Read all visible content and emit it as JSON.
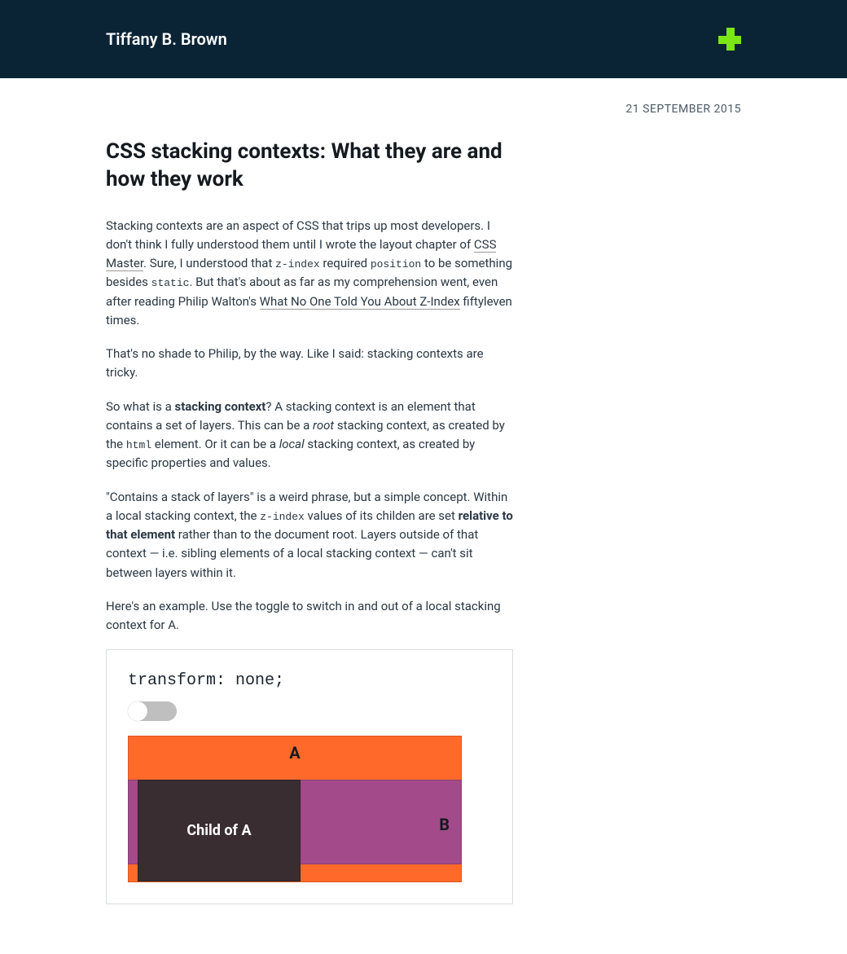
{
  "header": {
    "brand": "Tiffany B. Brown"
  },
  "meta": {
    "date": "21 SEPTEMBER 2015"
  },
  "article": {
    "title": "CSS stacking contexts: What they are and how they work",
    "p1_a": "Stacking contexts are an aspect of CSS that trips up most developers. I don't think I fully understood them until I wrote the layout chapter of ",
    "p1_link1": "CSS Master",
    "p1_b": ". Sure, I understood that ",
    "p1_code1": "z-index",
    "p1_c": " required ",
    "p1_code2": "position",
    "p1_d": " to be something besides ",
    "p1_code3": "static",
    "p1_e": ". But that's about as far as my comprehension went, even after reading Philip Walton's ",
    "p1_link2": "What No One Told You About Z-Index",
    "p1_f": " fiftyleven times.",
    "p2": "That's no shade to Philip, by the way. Like I said: stacking contexts are tricky.",
    "p3_a": "So what is a ",
    "p3_strong1": "stacking context",
    "p3_b": "? A stacking context is an element that contains a set of layers. This can be a ",
    "p3_em1": "root",
    "p3_c": " stacking context, as created by the ",
    "p3_code1": "html",
    "p3_d": " element. Or it can be a ",
    "p3_em2": "local",
    "p3_e": " stacking context, as created by specific properties and values.",
    "p4_a": "\"Contains a stack of layers\" is a weird phrase, but a simple concept. Within a local stacking context, the ",
    "p4_code1": "z-index",
    "p4_b": " values of its childen are set ",
    "p4_strong1": "relative to that element",
    "p4_c": " rather than to the document root. Layers outside of that context — i.e. sibling elements of a local stacking context — can't sit between layers within it.",
    "p5": "Here's an example. Use the toggle to switch in and out of a local stacking context for A."
  },
  "demo": {
    "label": "transform: none;",
    "boxA": "A",
    "boxB": "B",
    "childA": "Child of A"
  }
}
